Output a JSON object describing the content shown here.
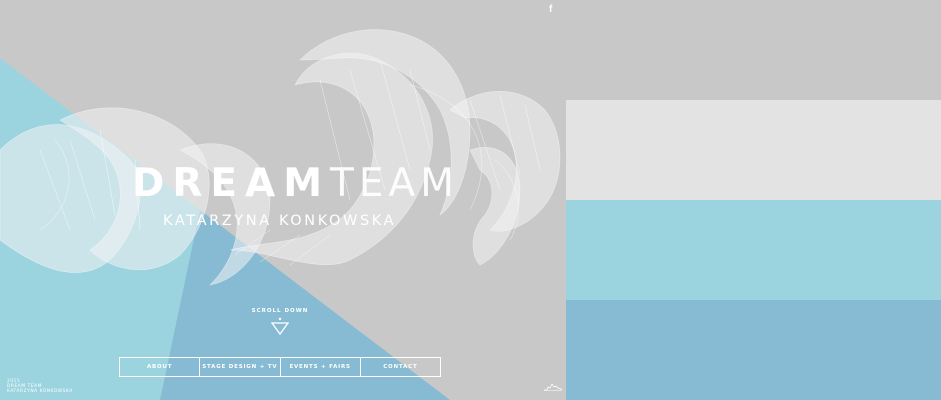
{
  "hero": {
    "title_bold": "DREAM",
    "title_light": "TEAM",
    "subtitle": "KATARZYNA KONKOWSKA",
    "scroll_label": "SCROLL DOWN",
    "facebook_label": "f"
  },
  "nav": {
    "items": [
      "ABOUT",
      "STAGE DESIGN + TV",
      "EVENTS + FAIRS",
      "CONTACT"
    ]
  },
  "credit": {
    "lines": [
      "2015",
      "DREAM TEAM",
      "KATARZYNA KONKOWSKA"
    ]
  },
  "palette": {
    "colors": [
      "#c8c8c8",
      "#e3e3e3",
      "#9bd3df",
      "#86bbd3"
    ]
  },
  "icons": {
    "facebook": "facebook-icon",
    "scroll": "triangle-down-icon",
    "logo": "skyline-logo-icon"
  }
}
